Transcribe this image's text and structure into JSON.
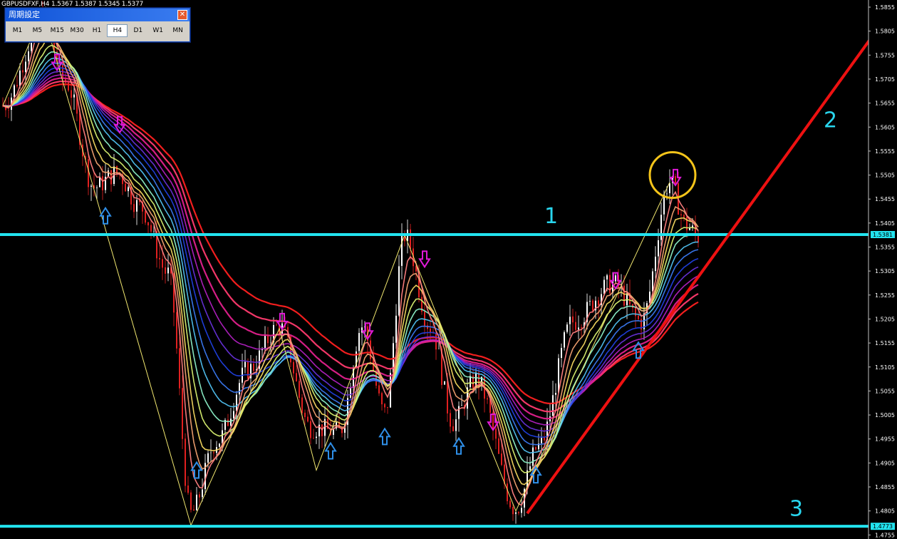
{
  "symbol_header": "GBPUSDFXF,H4  1.5367 1.5387 1.5345 1.5377",
  "period_panel": {
    "title": "周期設定",
    "close_glyph": "✕",
    "timeframes": [
      "M1",
      "M5",
      "M15",
      "M30",
      "H1",
      "H4",
      "D1",
      "W1",
      "MN"
    ],
    "active": "H4"
  },
  "colors": {
    "background": "#000000",
    "candle": "#e02020",
    "candle_wick": "#ffffff",
    "horizontal_lines": "#22e3ef",
    "trendline": "#ee1111",
    "zigzag": "#f2e870",
    "up_arrow": "#2f8fe8",
    "down_arrow": "#e01ad8",
    "highlight_circle": "#f4c41a",
    "ribbon": [
      "#ff2020",
      "#ff3a6e",
      "#e0208c",
      "#b020c0",
      "#6630d8",
      "#2040e0",
      "#3a78f0",
      "#50c0f0",
      "#8cf0c8",
      "#d8f070",
      "#f4d860",
      "#f0a070",
      "#ff8080"
    ]
  },
  "chart_data": {
    "type": "line",
    "title": "",
    "xlabel": "",
    "ylabel": "",
    "ylim": [
      1.4765,
      1.5885
    ],
    "y_ticks": [
      "1.5855",
      "1.5805",
      "1.5755",
      "1.5705",
      "1.5655",
      "1.5605",
      "1.5555",
      "1.5505",
      "1.5455",
      "1.5405",
      "1.5355",
      "1.5305",
      "1.5255",
      "1.5205",
      "1.5155",
      "1.5105",
      "1.5055",
      "1.5005",
      "1.4955",
      "1.4905",
      "1.4855",
      "1.4805",
      "1.4755"
    ],
    "y_tick_values": [
      1.5855,
      1.5805,
      1.5755,
      1.5705,
      1.5655,
      1.5605,
      1.5555,
      1.5505,
      1.5455,
      1.5405,
      1.5355,
      1.5305,
      1.5255,
      1.5205,
      1.5155,
      1.5105,
      1.5055,
      1.5005,
      1.4955,
      1.4905,
      1.4855,
      1.4805,
      1.4755
    ],
    "price_tags": [
      {
        "label": "1.5381",
        "value": 1.5381
      },
      {
        "label": "1.4773",
        "value": 1.4773
      }
    ],
    "bars": 245,
    "price_path": [
      {
        "bar": 0,
        "price": 1.565
      },
      {
        "bar": 14,
        "price": 1.583
      },
      {
        "bar": 22,
        "price": 1.57
      },
      {
        "bar": 32,
        "price": 1.548
      },
      {
        "bar": 40,
        "price": 1.551
      },
      {
        "bar": 48,
        "price": 1.544
      },
      {
        "bar": 58,
        "price": 1.53
      },
      {
        "bar": 66,
        "price": 1.48
      },
      {
        "bar": 75,
        "price": 1.495
      },
      {
        "bar": 86,
        "price": 1.51
      },
      {
        "bar": 97,
        "price": 1.519
      },
      {
        "bar": 108,
        "price": 1.498
      },
      {
        "bar": 118,
        "price": 1.497
      },
      {
        "bar": 126,
        "price": 1.519
      },
      {
        "bar": 134,
        "price": 1.501
      },
      {
        "bar": 141,
        "price": 1.538
      },
      {
        "bar": 150,
        "price": 1.519
      },
      {
        "bar": 158,
        "price": 1.499
      },
      {
        "bar": 166,
        "price": 1.508
      },
      {
        "bar": 180,
        "price": 1.481
      },
      {
        "bar": 188,
        "price": 1.494
      },
      {
        "bar": 200,
        "price": 1.52
      },
      {
        "bar": 214,
        "price": 1.528
      },
      {
        "bar": 224,
        "price": 1.52
      },
      {
        "bar": 234,
        "price": 1.549
      },
      {
        "bar": 240,
        "price": 1.54
      },
      {
        "bar": 244,
        "price": 1.5377
      }
    ],
    "zigzag": [
      {
        "bar": 0,
        "price": 1.565
      },
      {
        "bar": 14,
        "price": 1.5845
      },
      {
        "bar": 66,
        "price": 1.4775
      },
      {
        "bar": 97,
        "price": 1.5185
      },
      {
        "bar": 110,
        "price": 1.489
      },
      {
        "bar": 141,
        "price": 1.538
      },
      {
        "bar": 180,
        "price": 1.4805
      },
      {
        "bar": 234,
        "price": 1.549
      }
    ],
    "horizontal_lines": [
      1.5381,
      1.4773
    ],
    "trendline": {
      "from": {
        "bar": 184,
        "price": 1.48
      },
      "to": {
        "bar": 307,
        "price": 1.581
      }
    },
    "down_arrows": [
      {
        "bar": 19,
        "price": 1.574
      },
      {
        "bar": 41,
        "price": 1.561
      },
      {
        "bar": 98,
        "price": 1.52
      },
      {
        "bar": 128,
        "price": 1.518
      },
      {
        "bar": 148,
        "price": 1.533
      },
      {
        "bar": 172,
        "price": 1.499
      },
      {
        "bar": 215,
        "price": 1.5285
      },
      {
        "bar": 236,
        "price": 1.55
      }
    ],
    "up_arrows": [
      {
        "bar": 36,
        "price": 1.542
      },
      {
        "bar": 68,
        "price": 1.489
      },
      {
        "bar": 115,
        "price": 1.493
      },
      {
        "bar": 134,
        "price": 1.496
      },
      {
        "bar": 160,
        "price": 1.494
      },
      {
        "bar": 187,
        "price": 1.488
      },
      {
        "bar": 223,
        "price": 1.514
      }
    ],
    "highlight": {
      "bar": 235,
      "price": 1.5505
    },
    "annotations": [
      {
        "text": "1",
        "bar": 190,
        "price": 1.5405
      },
      {
        "text": "2",
        "bar": 288,
        "price": 1.5605
      },
      {
        "text": "3",
        "bar": 276,
        "price": 1.4795
      }
    ]
  }
}
